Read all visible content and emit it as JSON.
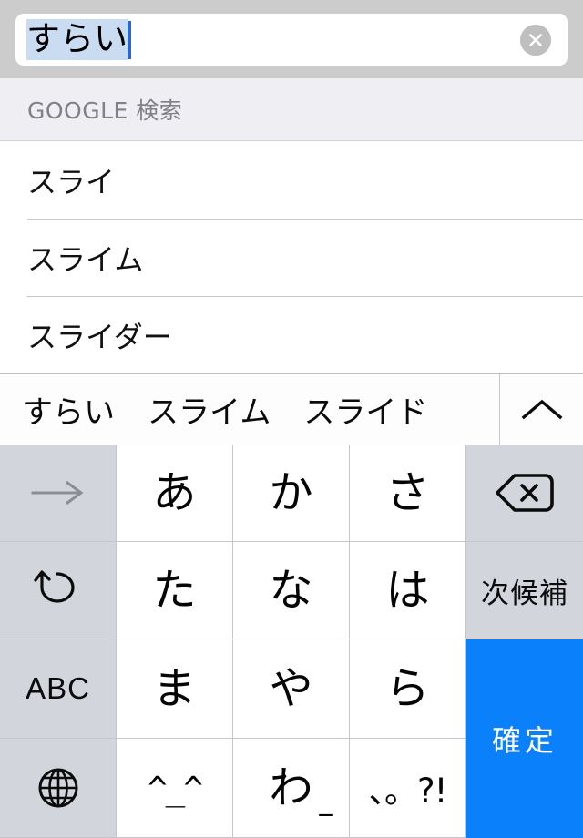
{
  "search": {
    "composing_text": "すらい",
    "clear_icon": "clear-circle-x-icon"
  },
  "suggestions": {
    "section_title": "GOOGLE 検索",
    "items": [
      {
        "label": "スライ"
      },
      {
        "label": "スライム"
      },
      {
        "label": "スライダー"
      }
    ]
  },
  "candidate_bar": {
    "candidates": [
      {
        "label": "すらい"
      },
      {
        "label": "スライム"
      },
      {
        "label": "スライド"
      }
    ],
    "expand_icon": "chevron-up-icon"
  },
  "keyboard": {
    "rows": [
      [
        {
          "label": "→",
          "type": "func",
          "icon": "arrow-right-icon"
        },
        {
          "label": "あ",
          "type": "kana"
        },
        {
          "label": "か",
          "type": "kana"
        },
        {
          "label": "さ",
          "type": "kana"
        },
        {
          "label": "",
          "type": "func",
          "icon": "delete-backspace-icon"
        }
      ],
      [
        {
          "label": "↺",
          "type": "func",
          "icon": "undo-icon"
        },
        {
          "label": "た",
          "type": "kana"
        },
        {
          "label": "な",
          "type": "kana"
        },
        {
          "label": "は",
          "type": "kana"
        },
        {
          "label": "次候補",
          "type": "func"
        }
      ],
      [
        {
          "label": "ABC",
          "type": "func"
        },
        {
          "label": "ま",
          "type": "kana"
        },
        {
          "label": "や",
          "type": "kana"
        },
        {
          "label": "ら",
          "type": "kana"
        },
        {
          "label": "確定",
          "type": "enter"
        }
      ],
      [
        {
          "label": "",
          "type": "func",
          "icon": "globe-icon"
        },
        {
          "label": "^_^",
          "type": "kana"
        },
        {
          "label": "わ",
          "type": "kana"
        },
        {
          "label": "、。?!",
          "type": "kana"
        }
      ]
    ]
  },
  "colors": {
    "accent_blue": "#0a80fa",
    "caret_blue": "#2867d6",
    "composing_highlight": "#c9dcf2",
    "chrome_gray": "#cccccc",
    "func_key_gray": "#d2d5dc",
    "section_header_bg": "#eeeef3"
  }
}
